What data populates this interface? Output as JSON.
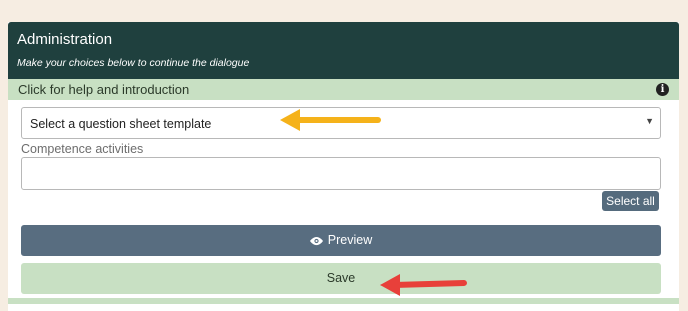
{
  "header": {
    "title": "Administration",
    "subtitle": "Make your choices below to continue the dialogue"
  },
  "help": {
    "label": "Click for help and introduction",
    "icon": "info-icon"
  },
  "template_select": {
    "value": "Select a question sheet template",
    "icon": "caret-down-icon"
  },
  "competence": {
    "label": "Competence activities",
    "value": ""
  },
  "buttons": {
    "select_all": "Select all",
    "preview": "Preview",
    "preview_icon": "eye-icon",
    "save": "Save"
  },
  "annotations": {
    "arrow_1_color": "#f5b21a",
    "arrow_2_color": "#e8403a"
  },
  "colors": {
    "header_bg": "#1f403e",
    "accent_green": "#c8e0c3",
    "button_slate": "#586d80",
    "page_bg": "#f6ede2"
  }
}
